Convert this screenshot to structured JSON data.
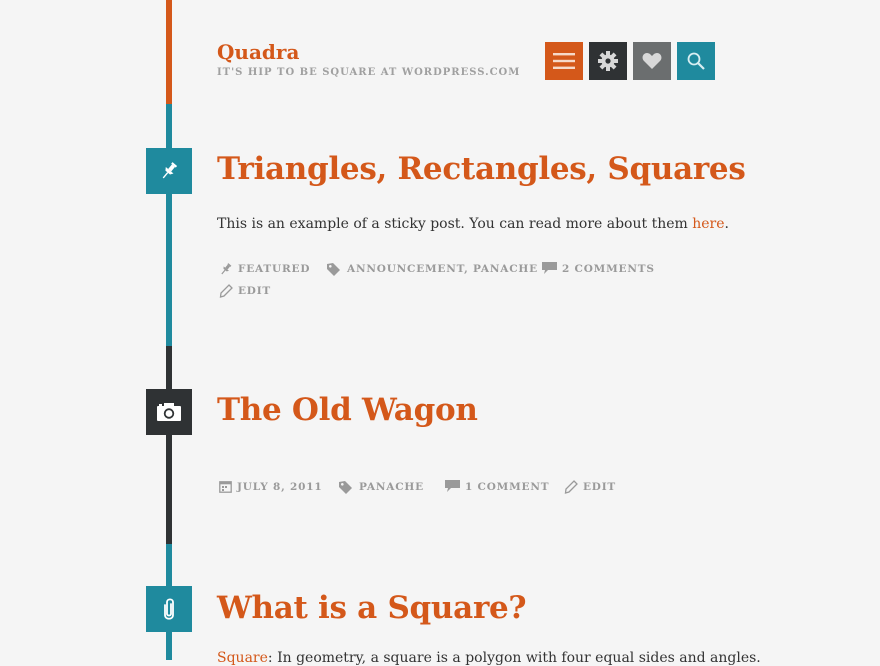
{
  "site": {
    "title": "Quadra",
    "tagline": "IT'S HIP TO BE SQUARE AT WORDPRESS.COM"
  },
  "header_buttons": [
    {
      "name": "menu",
      "icon": "menu-icon",
      "color": "#d4581a"
    },
    {
      "name": "settings",
      "icon": "gear-icon",
      "color": "#2f3234"
    },
    {
      "name": "like",
      "icon": "heart-icon",
      "color": "#6b6e6f"
    },
    {
      "name": "search",
      "icon": "search-icon",
      "color": "#1f8a9e"
    }
  ],
  "colors": {
    "accent": "#d4581a",
    "teal": "#1f8a9e",
    "dark": "#2f3234",
    "meta": "#9a9a9a"
  },
  "posts": [
    {
      "title": "Triangles, Rectangles, Squares",
      "format_icon": "pin-icon",
      "body_prefix": "This is an example of a sticky post. You can read more about them ",
      "body_link": "here",
      "body_suffix": ".",
      "meta": {
        "featured": "FEATURED",
        "tags": "ANNOUNCEMENT, PANACHE",
        "comments": "2 COMMENTS",
        "edit": "EDIT"
      }
    },
    {
      "title": "The Old Wagon",
      "format_icon": "camera-icon",
      "meta": {
        "date": "JULY 8, 2011",
        "tags": "PANACHE",
        "comments": "1 COMMENT",
        "edit": "EDIT"
      }
    },
    {
      "title": "What is a Square?",
      "format_icon": "paperclip-icon",
      "excerpt_link": "Square",
      "excerpt_rest": ": In geometry, a square is a polygon with four equal sides and angles."
    }
  ]
}
